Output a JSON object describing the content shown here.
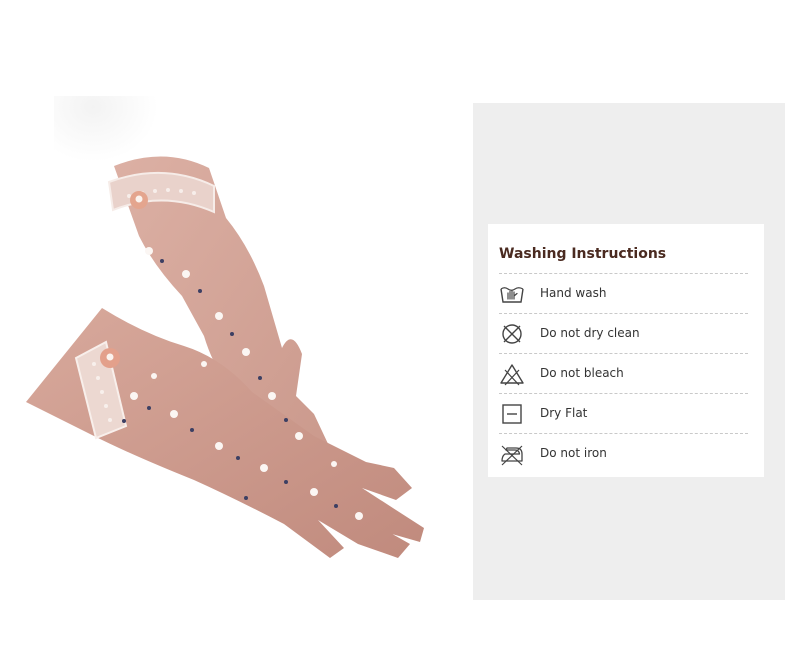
{
  "panel": {
    "title": "Washing Instructions",
    "background_color": "#eeeeee",
    "items": [
      {
        "icon": "hand-wash-icon",
        "label": "Hand wash"
      },
      {
        "icon": "do-not-dry-clean-icon",
        "label": "Do not dry clean"
      },
      {
        "icon": "do-not-bleach-icon",
        "label": "Do not bleach"
      },
      {
        "icon": "dry-flat-icon",
        "label": "Dry Flat"
      },
      {
        "icon": "do-not-iron-icon",
        "label": "Do not iron"
      }
    ]
  },
  "product": {
    "image": "pink floral lace-trim gloves",
    "glove_color": "#d9a89b"
  }
}
